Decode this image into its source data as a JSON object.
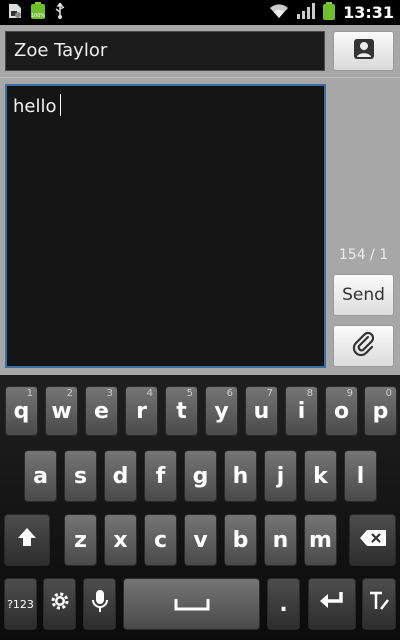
{
  "status_bar": {
    "time": "13:31",
    "icons": [
      "sim-card-icon",
      "battery-charging-icon",
      "usb-icon",
      "wifi-icon",
      "signal-icon",
      "battery-icon"
    ]
  },
  "compose": {
    "recipient": "Zoe Taylor",
    "message": "hello",
    "counter": "154 / 1",
    "send_label": "Send",
    "contact_icon": "contact-icon",
    "attach_icon": "paperclip-icon"
  },
  "keyboard": {
    "row1": [
      {
        "key": "q",
        "num": "1"
      },
      {
        "key": "w",
        "num": "2"
      },
      {
        "key": "e",
        "num": "3"
      },
      {
        "key": "r",
        "num": "4"
      },
      {
        "key": "t",
        "num": "5"
      },
      {
        "key": "y",
        "num": "6"
      },
      {
        "key": "u",
        "num": "7"
      },
      {
        "key": "i",
        "num": "8"
      },
      {
        "key": "o",
        "num": "9"
      },
      {
        "key": "p",
        "num": "0"
      }
    ],
    "row2": [
      "a",
      "s",
      "d",
      "f",
      "g",
      "h",
      "j",
      "k",
      "l"
    ],
    "row3": [
      "z",
      "x",
      "c",
      "v",
      "b",
      "n",
      "m"
    ],
    "symbols_label": "?123",
    "period": ".",
    "icons": {
      "shift": "shift-icon",
      "backspace": "backspace-icon",
      "settings": "gear-icon",
      "voice": "microphone-icon",
      "space": "space-icon",
      "enter": "enter-icon",
      "text_input": "text-input-icon"
    }
  },
  "colors": {
    "compose_bg": "#a7a7a7",
    "field_bg": "#151515",
    "focus_border": "#3b6fa3",
    "key_bg": "#5e5e5e"
  }
}
